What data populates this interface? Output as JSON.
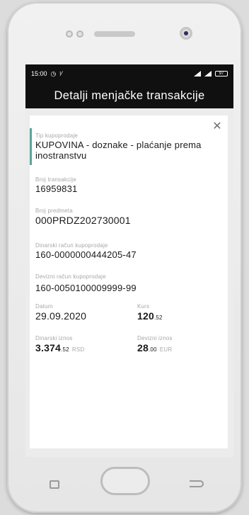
{
  "status_bar": {
    "time": "15:00",
    "alarm_icon": "alarm-icon",
    "extra_icon": "notification-icon",
    "battery": "97"
  },
  "app_bar": {
    "title": "Detalji menjačke transakcije"
  },
  "details": {
    "type_label": "Tip kupoprodaje",
    "type_value": "KUPOVINA - doznake - plaćanje prema inostranstvu",
    "transaction_label": "Broj transakcije",
    "transaction_value": "16959831",
    "subject_label": "Broj predmeta",
    "subject_value": "000PRDZ202730001",
    "dinar_account_label": "Dinarski račun kupoprodaje",
    "dinar_account_value": "160-0000000444205-47",
    "foreign_account_label": "Devizni račun kupoprodaje",
    "foreign_account_value": "160-0050100009999-99",
    "date_label": "Datum",
    "date_value": "29.09.2020",
    "rate_label": "Kurs",
    "rate_main": "120",
    "rate_decimals": ".52",
    "dinar_amount_label": "Dinarski iznos",
    "dinar_amount_main": "3.374",
    "dinar_amount_decimals": ".52",
    "dinar_currency": "RSD",
    "foreign_amount_label": "Devizni iznos",
    "foreign_amount_main": "28",
    "foreign_amount_decimals": ".00",
    "foreign_currency": "EUR"
  },
  "colors": {
    "accent": "#5aa59a",
    "app_bar": "#101010"
  }
}
